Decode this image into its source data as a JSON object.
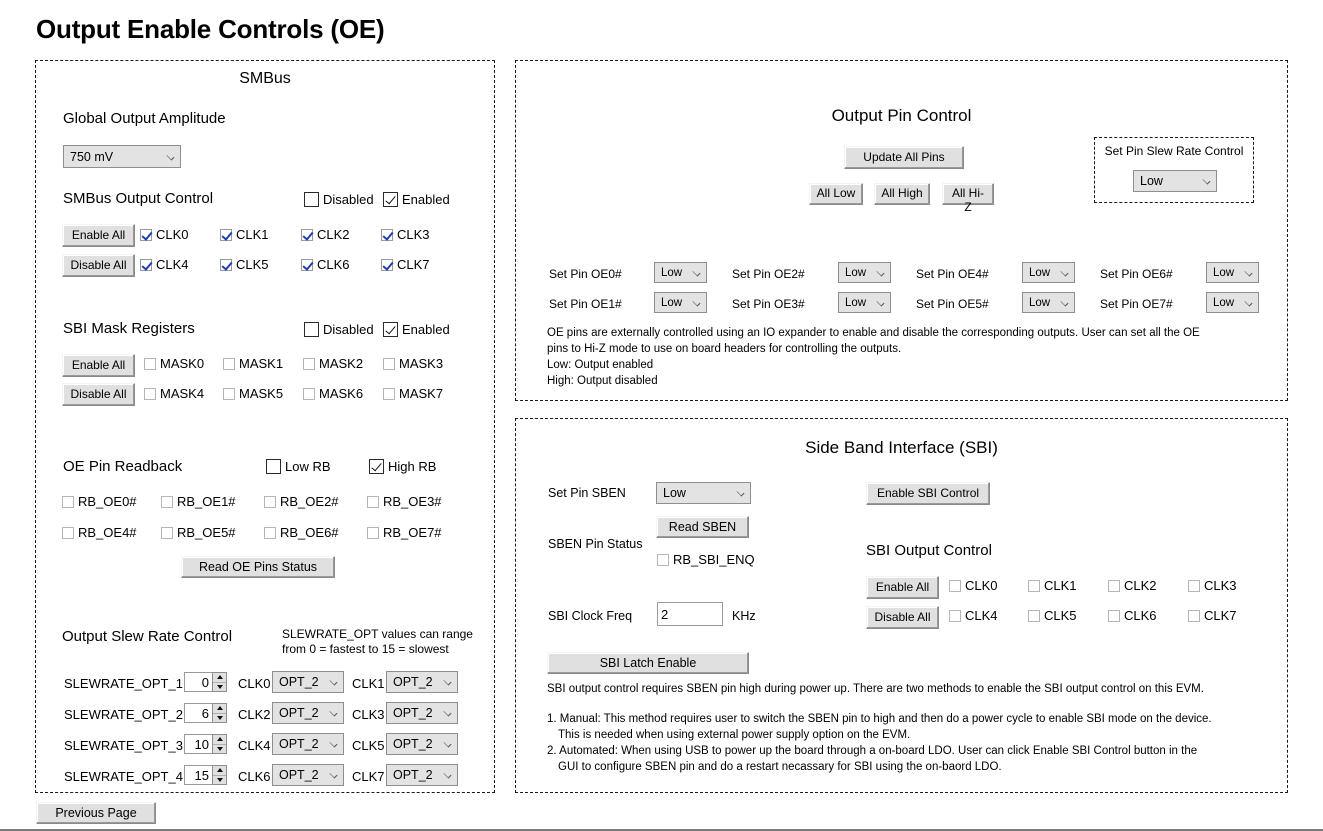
{
  "page": {
    "title": "Output Enable Controls (OE)",
    "previous_page_button": "Previous Page"
  },
  "smbus": {
    "panel_title": "SMBus",
    "global_output_amplitude": {
      "label": "Global Output Amplitude",
      "value": "750 mV"
    },
    "output_control": {
      "label": "SMBus Output Control",
      "disabled_label": "Disabled",
      "enabled_label": "Enabled",
      "disabled_checked": false,
      "enabled_checked": true,
      "enable_all": "Enable All",
      "disable_all": "Disable All",
      "clocks": [
        {
          "label": "CLK0",
          "checked": true
        },
        {
          "label": "CLK1",
          "checked": true
        },
        {
          "label": "CLK2",
          "checked": true
        },
        {
          "label": "CLK3",
          "checked": true
        },
        {
          "label": "CLK4",
          "checked": true
        },
        {
          "label": "CLK5",
          "checked": true
        },
        {
          "label": "CLK6",
          "checked": true
        },
        {
          "label": "CLK7",
          "checked": true
        }
      ]
    },
    "sbi_mask": {
      "label": "SBI Mask Registers",
      "disabled_label": "Disabled",
      "enabled_label": "Enabled",
      "disabled_checked": false,
      "enabled_checked": true,
      "enable_all": "Enable All",
      "disable_all": "Disable All",
      "masks": [
        {
          "label": "MASK0",
          "checked": false
        },
        {
          "label": "MASK1",
          "checked": false
        },
        {
          "label": "MASK2",
          "checked": false
        },
        {
          "label": "MASK3",
          "checked": false
        },
        {
          "label": "MASK4",
          "checked": false
        },
        {
          "label": "MASK5",
          "checked": false
        },
        {
          "label": "MASK6",
          "checked": false
        },
        {
          "label": "MASK7",
          "checked": false
        }
      ]
    },
    "oe_readback": {
      "label": "OE Pin Readback",
      "low_rb_label": "Low RB",
      "high_rb_label": "High RB",
      "low_rb_checked": false,
      "high_rb_checked": true,
      "pins": [
        {
          "label": "RB_OE0#",
          "checked": false
        },
        {
          "label": "RB_OE1#",
          "checked": false
        },
        {
          "label": "RB_OE2#",
          "checked": false
        },
        {
          "label": "RB_OE3#",
          "checked": false
        },
        {
          "label": "RB_OE4#",
          "checked": false
        },
        {
          "label": "RB_OE5#",
          "checked": false
        },
        {
          "label": "RB_OE6#",
          "checked": false
        },
        {
          "label": "RB_OE7#",
          "checked": false
        }
      ],
      "read_button": "Read OE Pins Status"
    },
    "slew_rate": {
      "label": "Output Slew Rate Control",
      "hint_line1": "SLEWRATE_OPT values can range",
      "hint_line2": "from 0 = fastest to 15 = slowest",
      "opts": [
        {
          "label": "SLEWRATE_OPT_1",
          "value": "0"
        },
        {
          "label": "SLEWRATE_OPT_2",
          "value": "6"
        },
        {
          "label": "SLEWRATE_OPT_3",
          "value": "10"
        },
        {
          "label": "SLEWRATE_OPT_4",
          "value": "15"
        }
      ],
      "clocks": [
        {
          "label": "CLK0",
          "value": "OPT_2"
        },
        {
          "label": "CLK1",
          "value": "OPT_2"
        },
        {
          "label": "CLK2",
          "value": "OPT_2"
        },
        {
          "label": "CLK3",
          "value": "OPT_2"
        },
        {
          "label": "CLK4",
          "value": "OPT_2"
        },
        {
          "label": "CLK5",
          "value": "OPT_2"
        },
        {
          "label": "CLK6",
          "value": "OPT_2"
        },
        {
          "label": "CLK7",
          "value": "OPT_2"
        }
      ]
    }
  },
  "output_pin_control": {
    "panel_title": "Output Pin Control",
    "update_all_pins": "Update All Pins",
    "all_low": "All Low",
    "all_high": "All High",
    "all_hiz": "All Hi-Z",
    "slew_box": {
      "label": "Set Pin Slew Rate Control",
      "value": "Low"
    },
    "pins": [
      {
        "label": "Set Pin OE0#",
        "value": "Low"
      },
      {
        "label": "Set Pin OE1#",
        "value": "Low"
      },
      {
        "label": "Set Pin OE2#",
        "value": "Low"
      },
      {
        "label": "Set Pin OE3#",
        "value": "Low"
      },
      {
        "label": "Set Pin OE4#",
        "value": "Low"
      },
      {
        "label": "Set Pin OE5#",
        "value": "Low"
      },
      {
        "label": "Set Pin OE6#",
        "value": "Low"
      },
      {
        "label": "Set Pin OE7#",
        "value": "Low"
      }
    ],
    "desc_line1": "OE pins are externally controlled using an IO expander to enable and disable the corresponding outputs. User can set all the OE",
    "desc_line2": "pins to Hi-Z mode to use on board headers for controlling the outputs.",
    "desc_line3": "Low:  Output enabled",
    "desc_line4": "High: Output disabled"
  },
  "sbi": {
    "panel_title": "Side Band Interface (SBI)",
    "set_pin_sben_label": "Set Pin SBEN",
    "set_pin_sben_value": "Low",
    "sben_pin_status_label": "SBEN Pin Status",
    "read_sben_button": "Read SBEN",
    "rb_sbi_enq_label": "RB_SBI_ENQ",
    "rb_sbi_enq_checked": false,
    "sbi_clock_freq_label": "SBI Clock Freq",
    "sbi_clock_freq_value": "2",
    "sbi_clock_freq_unit": "KHz",
    "sbi_latch_enable": "SBI Latch Enable",
    "enable_sbi_control": "Enable SBI Control",
    "output_control_label": "SBI Output Control",
    "enable_all": "Enable All",
    "disable_all": "Disable All",
    "clocks": [
      {
        "label": "CLK0",
        "checked": false
      },
      {
        "label": "CLK1",
        "checked": false
      },
      {
        "label": "CLK2",
        "checked": false
      },
      {
        "label": "CLK3",
        "checked": false
      },
      {
        "label": "CLK4",
        "checked": false
      },
      {
        "label": "CLK5",
        "checked": false
      },
      {
        "label": "CLK6",
        "checked": false
      },
      {
        "label": "CLK7",
        "checked": false
      }
    ],
    "note_intro": "SBI output control requires SBEN pin high during power up. There are  two methods to enable the SBI output control on this EVM.",
    "note_1a": "1. Manual: This method requires user to switch the SBEN pin to high and then do a power cycle to enable SBI mode on the device.",
    "note_1b": "This is needed when using external power supply option on the EVM.",
    "note_2a": "2. Automated: When using USB to power up the board through a on-board LDO. User can click Enable SBI Control button in the",
    "note_2b": "GUI to configure SBEN pin and do a restart necassary for SBI using the on-baord LDO."
  }
}
